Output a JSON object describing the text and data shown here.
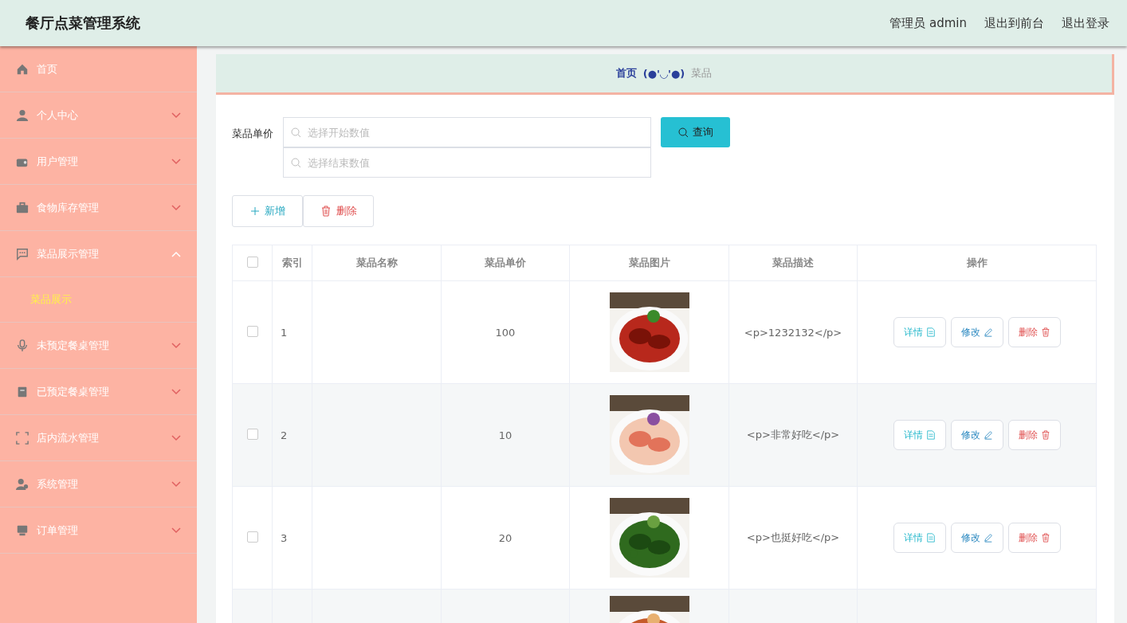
{
  "header": {
    "title": "餐厅点菜管理系统",
    "links": [
      "管理员 admin",
      "退出到前台",
      "退出登录"
    ]
  },
  "sidebar": {
    "items": [
      {
        "label": "首页"
      },
      {
        "label": "个人中心",
        "expanded": false
      },
      {
        "label": "用户管理",
        "expanded": false
      },
      {
        "label": "食物库存管理",
        "expanded": false
      },
      {
        "label": "菜品展示管理",
        "expanded": true,
        "children": [
          {
            "label": "菜品展示",
            "selected": true
          }
        ]
      },
      {
        "label": "未预定餐桌管理",
        "expanded": false
      },
      {
        "label": "已预定餐桌管理",
        "expanded": false
      },
      {
        "label": "店内流水管理",
        "expanded": false
      },
      {
        "label": "系统管理",
        "expanded": false
      },
      {
        "label": "订单管理",
        "expanded": false
      }
    ]
  },
  "breadcrumb": {
    "home": "首页",
    "separator": "(●'◡'●)",
    "current": "菜品"
  },
  "search": {
    "label": "菜品单价",
    "fields": [
      {
        "placeholder": "选择开始数值"
      },
      {
        "placeholder": "选择结束数值"
      }
    ],
    "button": "查询"
  },
  "actions": {
    "add": "新增",
    "delete": "删除"
  },
  "table": {
    "all_checked": false,
    "columns": [
      "索引",
      "菜品名称",
      "菜品单价",
      "菜品图片",
      "菜品描述",
      "操作"
    ],
    "rows": [
      {
        "index": "1",
        "price": "100",
        "description": "<p>1232132</p>",
        "checked": false,
        "actions": [
          "详情",
          "修改",
          "删除"
        ]
      },
      {
        "index": "2",
        "price": "10",
        "description": "<p>非常好吃</p>",
        "checked": false,
        "actions": [
          "详情",
          "修改",
          "删除"
        ]
      },
      {
        "index": "3",
        "price": "20",
        "description": "<p>也挺好吃</p>",
        "checked": false,
        "actions": [
          "详情",
          "修改",
          "删除"
        ]
      },
      {
        "kind": "picture"
      }
    ]
  }
}
